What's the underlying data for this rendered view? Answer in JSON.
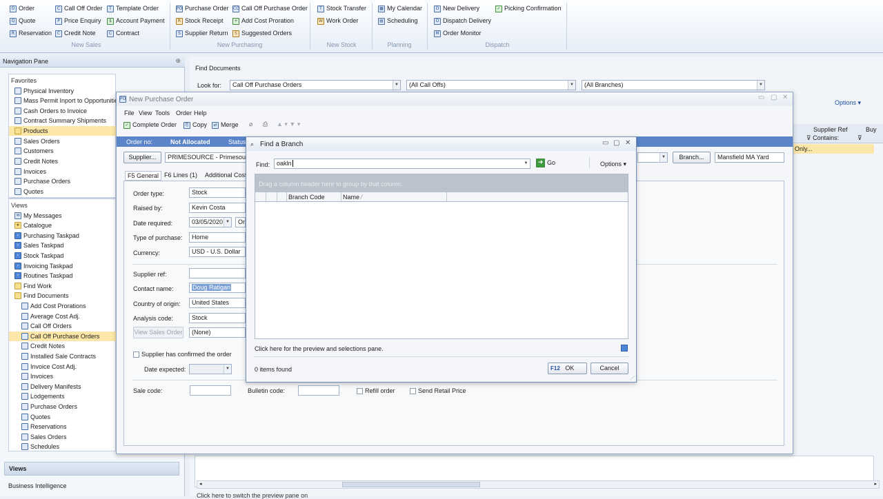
{
  "ribbon": {
    "new_sales": {
      "group": "New Sales",
      "items": [
        "Order",
        "Quote",
        "Reservation",
        "Call Off Order",
        "Price Enquiry",
        "Credit Note",
        "Template Order",
        "Account Payment",
        "Contract"
      ]
    },
    "new_purchasing": {
      "group": "New Purchasing",
      "items": [
        "Purchase Order",
        "Stock Receipt",
        "Supplier Return",
        "Call Off Purchase Order",
        "Add Cost Proration",
        "Suggested Orders"
      ]
    },
    "new_stock": {
      "group": "New Stock",
      "items": [
        "Stock Transfer",
        "Work Order"
      ]
    },
    "planning": {
      "group": "Planning",
      "items": [
        "My Calendar",
        "Scheduling"
      ]
    },
    "dispatch": {
      "group": "Dispatch",
      "items": [
        "New Delivery",
        "Dispatch Delivery",
        "Order Monitor",
        "Picking Confirmation"
      ]
    }
  },
  "nav": {
    "title": "Navigation Pane",
    "favorites_title": "Favorites",
    "favorites": [
      "Physical Inventory",
      "Mass Permit Inport to Opportunities",
      "Cash Orders to Invoice",
      "Contract Summary Shipments",
      "Products",
      "Sales Orders",
      "Customers",
      "Credit Notes",
      "Invoices",
      "Purchase Orders",
      "Quotes"
    ],
    "views_title": "Views",
    "views": [
      "My Messages",
      "Catalogue",
      "Purchasing Taskpad",
      "Sales Taskpad",
      "Stock Taskpad",
      "Invoicing Taskpad",
      "Routines Taskpad",
      "Find Work",
      "Find Documents"
    ],
    "find_documents": [
      "Add Cost Prorations",
      "Average Cost Adj.",
      "Call Off Orders",
      "Call Off Purchase Orders",
      "Credit Notes",
      "Installed Sale Contracts",
      "Invoice Cost Adj.",
      "Invoices",
      "Delivery Manifests",
      "Lodgements",
      "Purchase Orders",
      "Quotes",
      "Reservations",
      "Sales Orders",
      "Schedules"
    ],
    "bottom_views": "Views",
    "bottom_bi": "Business Intelligence"
  },
  "find_docs": {
    "title": "Find Documents",
    "look_for_label": "Look for:",
    "look_for_value": "Call Off Purchase Orders",
    "filter2": "(All Call Offs)",
    "filter3": "(All Branches)",
    "options": "Options",
    "col_supplier_ref": "Supplier Ref",
    "col_contains": "Contains:",
    "col_buy": "Buy",
    "row_only": "Only...",
    "status_bar": "Click here to switch the preview pane on"
  },
  "po": {
    "title": "New Purchase Order",
    "menu": [
      "File",
      "View",
      "Tools",
      "Order",
      "Help"
    ],
    "toolbar": {
      "complete": "Complete Order",
      "copy": "Copy",
      "merge": "Merge"
    },
    "order_no_label": "Order no:",
    "order_no_value": "Not Allocated",
    "status_label": "Status",
    "supplier_btn": "Supplier...",
    "supplier_value": "PRIMESOURCE - Primesource (",
    "branch_btn": "Branch...",
    "branch_value": "Mansfield MA Yard",
    "tabs": [
      {
        "key": "F5",
        "label": "General"
      },
      {
        "key": "F6",
        "label": "Lines (1)"
      },
      {
        "key": "",
        "label": "Additional Costs"
      }
    ],
    "fields": {
      "order_type": {
        "label": "Order type:",
        "value": "Stock"
      },
      "raised_by": {
        "label": "Raised by:",
        "value": "Kevin Costa"
      },
      "date_required": {
        "label": "Date required:",
        "value": "03/05/2020",
        "extra": "On"
      },
      "type_of_purchase": {
        "label": "Type of purchase:",
        "value": "Home"
      },
      "currency": {
        "label": "Currency:",
        "value": "USD - U.S. Dollar"
      },
      "supplier_ref": {
        "label": "Supplier ref:",
        "value": ""
      },
      "contact_name": {
        "label": "Contact name:",
        "value": "Doug Ratigan"
      },
      "country": {
        "label": "Country of origin:",
        "value": "United States"
      },
      "analysis": {
        "label": "Analysis code:",
        "value": "Stock"
      },
      "view_sales_order": "View Sales Order",
      "none_value": "(None)",
      "confirmed": "Supplier has confirmed the order",
      "date_expected": "Date expected:",
      "sale_code": "Sale code:",
      "bulletin_code": "Bulletin code:",
      "refill": "Refill order",
      "send_retail": "Send Retail Price"
    }
  },
  "branch": {
    "title": "Find a Branch",
    "find_label": "Find:",
    "find_value": "oakln",
    "go": "Go",
    "options": "Options",
    "group_hint": "Drag a column header here to group by that column.",
    "col_code": "Branch Code",
    "col_name": "Name",
    "preview_link": "Click here for the preview and selections pane.",
    "count": "0 items found",
    "ok_key": "F12",
    "ok": "OK",
    "cancel": "Cancel"
  }
}
